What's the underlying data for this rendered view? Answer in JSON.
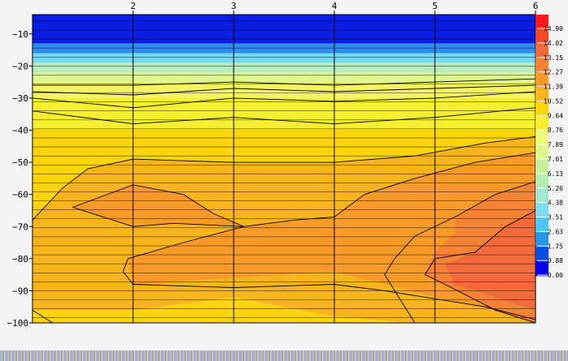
{
  "chart_data": {
    "type": "heatmap",
    "title": "",
    "xlabel": "",
    "ylabel": "",
    "x_ticks": [
      2,
      3,
      4,
      5,
      6
    ],
    "x_range": [
      1,
      6
    ],
    "y_ticks": [
      -10,
      -20,
      -30,
      -40,
      -50,
      -60,
      -70,
      -80,
      -90,
      -100
    ],
    "y_range": [
      -100,
      -4
    ],
    "colorbar": {
      "values": [
        "14.90",
        "14.02",
        "13.15",
        "12.27",
        "11.39",
        "10.52",
        "9.64",
        "8.76",
        "7.89",
        "7.01",
        "6.13",
        "5.26",
        "4.38",
        "3.51",
        "2.63",
        "1.75",
        "0.88",
        "0.00"
      ],
      "colors": [
        "#ff1a1a",
        "#f24a2a",
        "#f26a3a",
        "#f58235",
        "#f79a2a",
        "#f8b41c",
        "#fbd40a",
        "#f6ee2e",
        "#eef87a",
        "#dcf78c",
        "#c8f09a",
        "#b4ecb4",
        "#9ee8d2",
        "#7edcf0",
        "#4cc6f4",
        "#2596ea",
        "#0a4ce6",
        "#0000ee"
      ]
    },
    "bands": [
      {
        "from": -4,
        "to": -13,
        "color": "#0a1ee6"
      },
      {
        "from": -13,
        "to": -16,
        "color": "#2f8df2"
      },
      {
        "from": -16,
        "to": -19,
        "color": "#74d8f4"
      },
      {
        "from": -19,
        "to": -22,
        "color": "#b4ecbc"
      },
      {
        "from": -22,
        "to": -25,
        "color": "#dcf690"
      },
      {
        "from": -25,
        "to": -30,
        "color": "#f2f460"
      },
      {
        "from": -30,
        "to": -40,
        "color": "#f6ee30"
      },
      {
        "from": -40,
        "to": -100,
        "color": "#fbd40a"
      }
    ],
    "regions": [
      {
        "color": "#f8b41c",
        "points": [
          [
            1,
            -68
          ],
          [
            1.3,
            -58
          ],
          [
            1.55,
            -52
          ],
          [
            2,
            -49
          ],
          [
            3,
            -50
          ],
          [
            4,
            -50
          ],
          [
            4.8,
            -48
          ],
          [
            5.5,
            -44
          ],
          [
            6,
            -42
          ],
          [
            6,
            -100
          ],
          [
            4.8,
            -100
          ],
          [
            4,
            -98
          ],
          [
            3,
            -92
          ],
          [
            2,
            -96
          ],
          [
            1,
            -96
          ]
        ]
      },
      {
        "color": "#f79a2a",
        "points": [
          [
            3.1,
            -70
          ],
          [
            3.6,
            -68
          ],
          [
            4,
            -67
          ],
          [
            4.3,
            -60
          ],
          [
            4.8,
            -55
          ],
          [
            5.4,
            -50
          ],
          [
            6,
            -47
          ],
          [
            6,
            -99
          ],
          [
            5.5,
            -95
          ],
          [
            5,
            -92
          ],
          [
            4.5,
            -88
          ],
          [
            4,
            -84
          ],
          [
            3,
            -86
          ],
          [
            2,
            -88
          ],
          [
            1.95,
            -80
          ],
          [
            2.5,
            -75
          ]
        ]
      },
      {
        "color": "#f79a2a",
        "points": [
          [
            1.4,
            -64
          ],
          [
            2,
            -57
          ],
          [
            2.5,
            -60
          ],
          [
            2.8,
            -66
          ],
          [
            3.1,
            -70
          ],
          [
            2.4,
            -69
          ],
          [
            2,
            -70
          ]
        ]
      },
      {
        "color": "#f58235",
        "points": [
          [
            5.2,
            -67
          ],
          [
            5.6,
            -60
          ],
          [
            6,
            -56
          ],
          [
            6,
            -100
          ],
          [
            5.6,
            -96
          ],
          [
            5.1,
            -88
          ],
          [
            4.9,
            -85
          ],
          [
            5,
            -78
          ],
          [
            5.2,
            -72
          ]
        ]
      },
      {
        "color": "#f26a3a",
        "points": [
          [
            5.4,
            -78
          ],
          [
            5.7,
            -70
          ],
          [
            6,
            -65
          ],
          [
            6,
            -96
          ],
          [
            5.6,
            -92
          ],
          [
            5.2,
            -88
          ],
          [
            5.1,
            -82
          ]
        ]
      }
    ],
    "contours": [
      [
        [
          1,
          -26
        ],
        [
          2,
          -26
        ],
        [
          3,
          -25
        ],
        [
          4,
          -26
        ],
        [
          5,
          -25
        ],
        [
          6,
          -24
        ]
      ],
      [
        [
          1,
          -28
        ],
        [
          2,
          -29
        ],
        [
          3,
          -27
        ],
        [
          4,
          -28
        ],
        [
          5,
          -27
        ],
        [
          6,
          -26
        ]
      ],
      [
        [
          1,
          -30
        ],
        [
          2,
          -33
        ],
        [
          3,
          -30
        ],
        [
          4,
          -31
        ],
        [
          5,
          -30
        ],
        [
          6,
          -28
        ]
      ],
      [
        [
          1,
          -34
        ],
        [
          2,
          -38
        ],
        [
          3,
          -36
        ],
        [
          4,
          -38
        ],
        [
          5,
          -36
        ],
        [
          6,
          -33
        ]
      ],
      [
        [
          1,
          -68
        ],
        [
          1.3,
          -58
        ],
        [
          1.55,
          -52
        ],
        [
          2,
          -49
        ],
        [
          3,
          -50
        ],
        [
          4,
          -50
        ],
        [
          4.8,
          -48
        ],
        [
          5.5,
          -44
        ],
        [
          6,
          -42
        ]
      ],
      [
        [
          1,
          -96
        ],
        [
          1.2,
          -100
        ]
      ],
      [
        [
          3.1,
          -70
        ],
        [
          3.6,
          -68
        ],
        [
          4,
          -67
        ],
        [
          4.3,
          -60
        ],
        [
          4.8,
          -55
        ],
        [
          5.4,
          -50
        ],
        [
          6,
          -47
        ]
      ],
      [
        [
          1.4,
          -64
        ],
        [
          2,
          -57
        ],
        [
          2.5,
          -60
        ],
        [
          2.8,
          -66
        ],
        [
          3.1,
          -70
        ],
        [
          2.4,
          -69
        ],
        [
          2,
          -70
        ],
        [
          1.4,
          -64
        ]
      ],
      [
        [
          3.1,
          -70
        ],
        [
          2.5,
          -75
        ],
        [
          1.95,
          -80
        ],
        [
          1.9,
          -84
        ],
        [
          2,
          -88
        ],
        [
          3,
          -89
        ],
        [
          4,
          -88
        ],
        [
          4.5,
          -90
        ],
        [
          5.5,
          -95
        ],
        [
          6,
          -99
        ]
      ],
      [
        [
          6,
          -56
        ],
        [
          5.6,
          -60
        ],
        [
          5.2,
          -67
        ],
        [
          4.8,
          -73
        ],
        [
          4.6,
          -80
        ],
        [
          4.5,
          -85
        ],
        [
          4.6,
          -90
        ],
        [
          4.8,
          -100
        ]
      ],
      [
        [
          6,
          -65
        ],
        [
          5.7,
          -70
        ],
        [
          5.4,
          -78
        ],
        [
          5,
          -80
        ],
        [
          4.9,
          -85
        ],
        [
          5.1,
          -88
        ],
        [
          5.6,
          -96
        ],
        [
          6,
          -100
        ]
      ]
    ]
  }
}
